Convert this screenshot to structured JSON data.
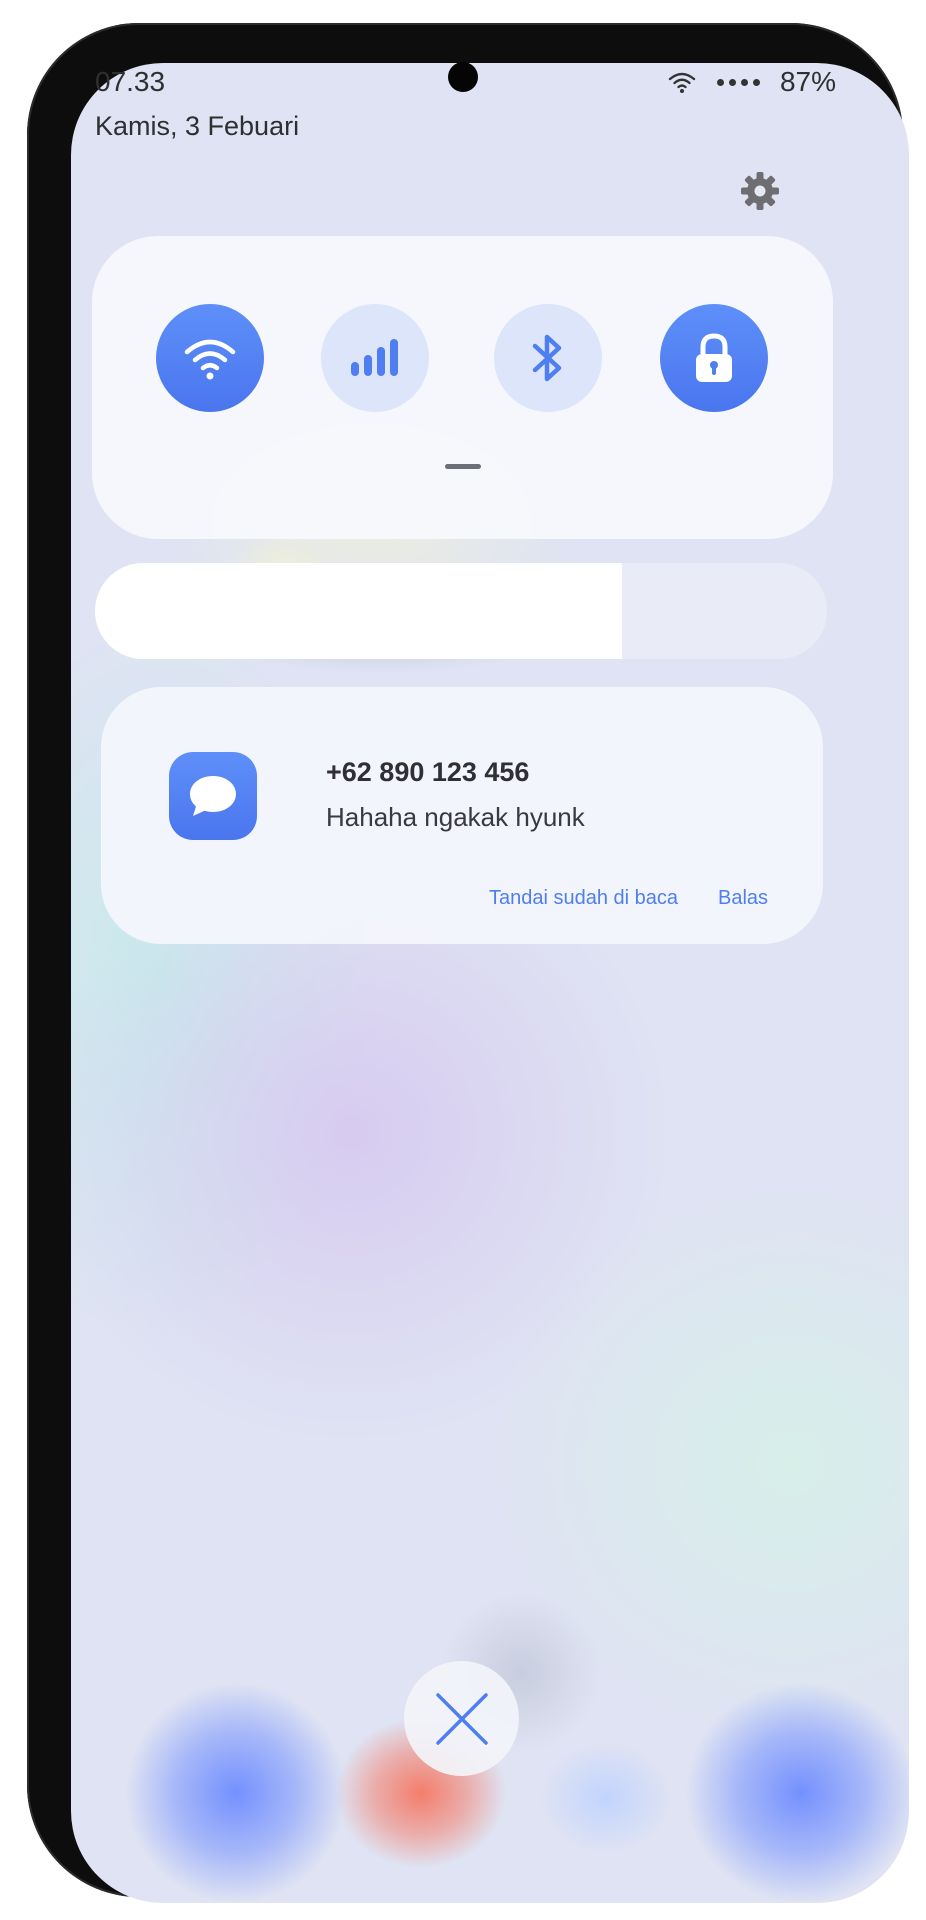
{
  "status_bar": {
    "time": "07.33",
    "date": "Kamis, 3 Febuari",
    "battery": "87%",
    "wifi_icon": "wifi-icon",
    "signal_icon": "signal-dots-icon"
  },
  "quick_settings": {
    "settings_icon": "gear-icon",
    "toggles": [
      {
        "icon": "wifi-icon",
        "state": "on"
      },
      {
        "icon": "mobile-data-icon",
        "state": "off"
      },
      {
        "icon": "bluetooth-icon",
        "state": "off"
      },
      {
        "icon": "lock-icon",
        "state": "on"
      }
    ]
  },
  "brightness": {
    "level": 0.72
  },
  "notification": {
    "app_icon": "message-icon",
    "title": "+62 890 123 456",
    "body": "Hahaha ngakak hyunk",
    "action_mark_read": "Tandai sudah di baca",
    "action_reply": "Balas"
  },
  "close_button": {
    "icon": "close-icon"
  },
  "colors": {
    "accent": "#5283F3",
    "toggle_off": "#DDE5FA",
    "background": "#DFE3F3"
  }
}
